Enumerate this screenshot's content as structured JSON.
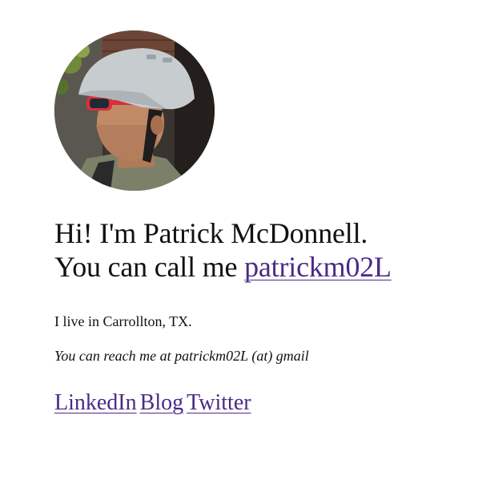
{
  "profile": {
    "photo_icon": "avatar-photo-helmet-sunglasses"
  },
  "intro": {
    "line1": "Hi! I'm Patrick McDonnell.",
    "line2_prefix": "You can call me ",
    "handle_link": "patrickm02L"
  },
  "location": "I live in Carrollton, TX.",
  "contact": "You can reach me at patrickm02L (at) gmail",
  "links": [
    {
      "label": "LinkedIn"
    },
    {
      "label": "Blog"
    },
    {
      "label": "Twitter"
    }
  ],
  "colors": {
    "link": "#4b2a86",
    "text": "#111111",
    "background": "#ffffff"
  }
}
